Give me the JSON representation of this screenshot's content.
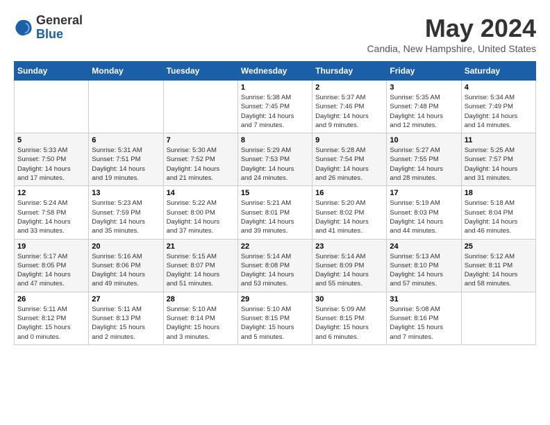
{
  "logo": {
    "general": "General",
    "blue": "Blue"
  },
  "header": {
    "month": "May 2024",
    "location": "Candia, New Hampshire, United States"
  },
  "weekdays": [
    "Sunday",
    "Monday",
    "Tuesday",
    "Wednesday",
    "Thursday",
    "Friday",
    "Saturday"
  ],
  "weeks": [
    [
      {
        "day": "",
        "info": ""
      },
      {
        "day": "",
        "info": ""
      },
      {
        "day": "",
        "info": ""
      },
      {
        "day": "1",
        "info": "Sunrise: 5:38 AM\nSunset: 7:45 PM\nDaylight: 14 hours\nand 7 minutes."
      },
      {
        "day": "2",
        "info": "Sunrise: 5:37 AM\nSunset: 7:46 PM\nDaylight: 14 hours\nand 9 minutes."
      },
      {
        "day": "3",
        "info": "Sunrise: 5:35 AM\nSunset: 7:48 PM\nDaylight: 14 hours\nand 12 minutes."
      },
      {
        "day": "4",
        "info": "Sunrise: 5:34 AM\nSunset: 7:49 PM\nDaylight: 14 hours\nand 14 minutes."
      }
    ],
    [
      {
        "day": "5",
        "info": "Sunrise: 5:33 AM\nSunset: 7:50 PM\nDaylight: 14 hours\nand 17 minutes."
      },
      {
        "day": "6",
        "info": "Sunrise: 5:31 AM\nSunset: 7:51 PM\nDaylight: 14 hours\nand 19 minutes."
      },
      {
        "day": "7",
        "info": "Sunrise: 5:30 AM\nSunset: 7:52 PM\nDaylight: 14 hours\nand 21 minutes."
      },
      {
        "day": "8",
        "info": "Sunrise: 5:29 AM\nSunset: 7:53 PM\nDaylight: 14 hours\nand 24 minutes."
      },
      {
        "day": "9",
        "info": "Sunrise: 5:28 AM\nSunset: 7:54 PM\nDaylight: 14 hours\nand 26 minutes."
      },
      {
        "day": "10",
        "info": "Sunrise: 5:27 AM\nSunset: 7:55 PM\nDaylight: 14 hours\nand 28 minutes."
      },
      {
        "day": "11",
        "info": "Sunrise: 5:25 AM\nSunset: 7:57 PM\nDaylight: 14 hours\nand 31 minutes."
      }
    ],
    [
      {
        "day": "12",
        "info": "Sunrise: 5:24 AM\nSunset: 7:58 PM\nDaylight: 14 hours\nand 33 minutes."
      },
      {
        "day": "13",
        "info": "Sunrise: 5:23 AM\nSunset: 7:59 PM\nDaylight: 14 hours\nand 35 minutes."
      },
      {
        "day": "14",
        "info": "Sunrise: 5:22 AM\nSunset: 8:00 PM\nDaylight: 14 hours\nand 37 minutes."
      },
      {
        "day": "15",
        "info": "Sunrise: 5:21 AM\nSunset: 8:01 PM\nDaylight: 14 hours\nand 39 minutes."
      },
      {
        "day": "16",
        "info": "Sunrise: 5:20 AM\nSunset: 8:02 PM\nDaylight: 14 hours\nand 41 minutes."
      },
      {
        "day": "17",
        "info": "Sunrise: 5:19 AM\nSunset: 8:03 PM\nDaylight: 14 hours\nand 44 minutes."
      },
      {
        "day": "18",
        "info": "Sunrise: 5:18 AM\nSunset: 8:04 PM\nDaylight: 14 hours\nand 46 minutes."
      }
    ],
    [
      {
        "day": "19",
        "info": "Sunrise: 5:17 AM\nSunset: 8:05 PM\nDaylight: 14 hours\nand 47 minutes."
      },
      {
        "day": "20",
        "info": "Sunrise: 5:16 AM\nSunset: 8:06 PM\nDaylight: 14 hours\nand 49 minutes."
      },
      {
        "day": "21",
        "info": "Sunrise: 5:15 AM\nSunset: 8:07 PM\nDaylight: 14 hours\nand 51 minutes."
      },
      {
        "day": "22",
        "info": "Sunrise: 5:14 AM\nSunset: 8:08 PM\nDaylight: 14 hours\nand 53 minutes."
      },
      {
        "day": "23",
        "info": "Sunrise: 5:14 AM\nSunset: 8:09 PM\nDaylight: 14 hours\nand 55 minutes."
      },
      {
        "day": "24",
        "info": "Sunrise: 5:13 AM\nSunset: 8:10 PM\nDaylight: 14 hours\nand 57 minutes."
      },
      {
        "day": "25",
        "info": "Sunrise: 5:12 AM\nSunset: 8:11 PM\nDaylight: 14 hours\nand 58 minutes."
      }
    ],
    [
      {
        "day": "26",
        "info": "Sunrise: 5:11 AM\nSunset: 8:12 PM\nDaylight: 15 hours\nand 0 minutes."
      },
      {
        "day": "27",
        "info": "Sunrise: 5:11 AM\nSunset: 8:13 PM\nDaylight: 15 hours\nand 2 minutes."
      },
      {
        "day": "28",
        "info": "Sunrise: 5:10 AM\nSunset: 8:14 PM\nDaylight: 15 hours\nand 3 minutes."
      },
      {
        "day": "29",
        "info": "Sunrise: 5:10 AM\nSunset: 8:15 PM\nDaylight: 15 hours\nand 5 minutes."
      },
      {
        "day": "30",
        "info": "Sunrise: 5:09 AM\nSunset: 8:15 PM\nDaylight: 15 hours\nand 6 minutes."
      },
      {
        "day": "31",
        "info": "Sunrise: 5:08 AM\nSunset: 8:16 PM\nDaylight: 15 hours\nand 7 minutes."
      },
      {
        "day": "",
        "info": ""
      }
    ]
  ]
}
